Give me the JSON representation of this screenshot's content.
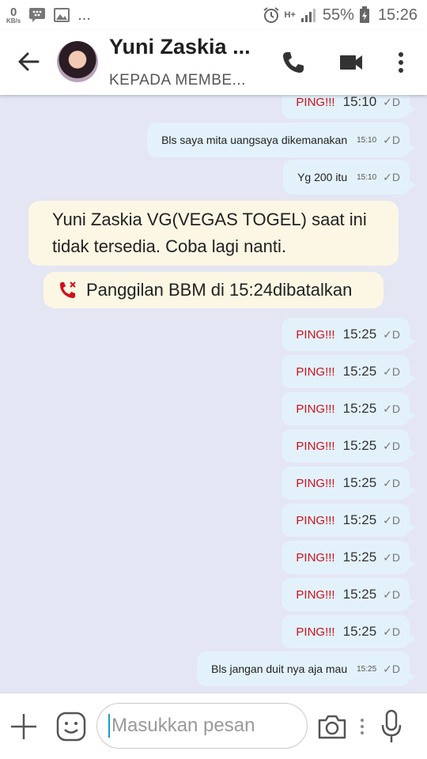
{
  "status_bar": {
    "data_speed_value": "0",
    "data_speed_unit": "KB/s",
    "more": "...",
    "network": "H+",
    "battery": "55%",
    "time": "15:26"
  },
  "header": {
    "title": "Yuni Zaskia ...",
    "subtitle": "KEPADA MEMBE..."
  },
  "messages": [
    {
      "ping": "PING!!!",
      "text": "",
      "time": "15:10",
      "size": "big",
      "check": "✓D"
    },
    {
      "ping": "",
      "text": "Bls saya mita uangsaya dikemanakan",
      "time": "15:10",
      "size": "small",
      "check": "✓D"
    },
    {
      "ping": "",
      "text": "Yg 200 itu",
      "time": "15:10",
      "size": "small",
      "check": "✓D"
    },
    {
      "ping": "PING!!!",
      "text": "",
      "time": "15:25",
      "size": "big",
      "check": "✓D"
    },
    {
      "ping": "PING!!!",
      "text": "",
      "time": "15:25",
      "size": "big",
      "check": "✓D"
    },
    {
      "ping": "PING!!!",
      "text": "",
      "time": "15:25",
      "size": "big",
      "check": "✓D"
    },
    {
      "ping": "PING!!!",
      "text": "",
      "time": "15:25",
      "size": "big",
      "check": "✓D"
    },
    {
      "ping": "PING!!!",
      "text": "",
      "time": "15:25",
      "size": "big",
      "check": "✓D"
    },
    {
      "ping": "PING!!!",
      "text": "",
      "time": "15:25",
      "size": "big",
      "check": "✓D"
    },
    {
      "ping": "PING!!!",
      "text": "",
      "time": "15:25",
      "size": "big",
      "check": "✓D"
    },
    {
      "ping": "PING!!!",
      "text": "",
      "time": "15:25",
      "size": "big",
      "check": "✓D"
    },
    {
      "ping": "PING!!!",
      "text": "",
      "time": "15:25",
      "size": "big",
      "check": "✓D"
    },
    {
      "ping": "",
      "text": "Bls jangan duit nya aja mau",
      "time": "15:25",
      "size": "small",
      "check": "✓D"
    }
  ],
  "system": {
    "unavailable_line1": "Yuni Zaskia VG(VEGAS TOGEL) saat ini",
    "unavailable_line2": "tidak tersedia. Coba lagi nanti.",
    "call_cancelled": "Panggilan BBM di 15:24dibatalkan"
  },
  "composer": {
    "placeholder": "Masukkan pesan"
  },
  "colors": {
    "ping": "#d0101a",
    "bubble_out": "#e3f1fb",
    "system_note": "#fbf7e4",
    "chat_bg": "#e4e6f4",
    "missed_call_icon": "#d0101a"
  },
  "icons": [
    "back-arrow-icon",
    "voice-call-icon",
    "video-call-icon",
    "overflow-menu-icon",
    "missed-call-icon",
    "add-icon",
    "emoji-icon",
    "camera-icon",
    "more-vert-icon",
    "microphone-icon"
  ]
}
